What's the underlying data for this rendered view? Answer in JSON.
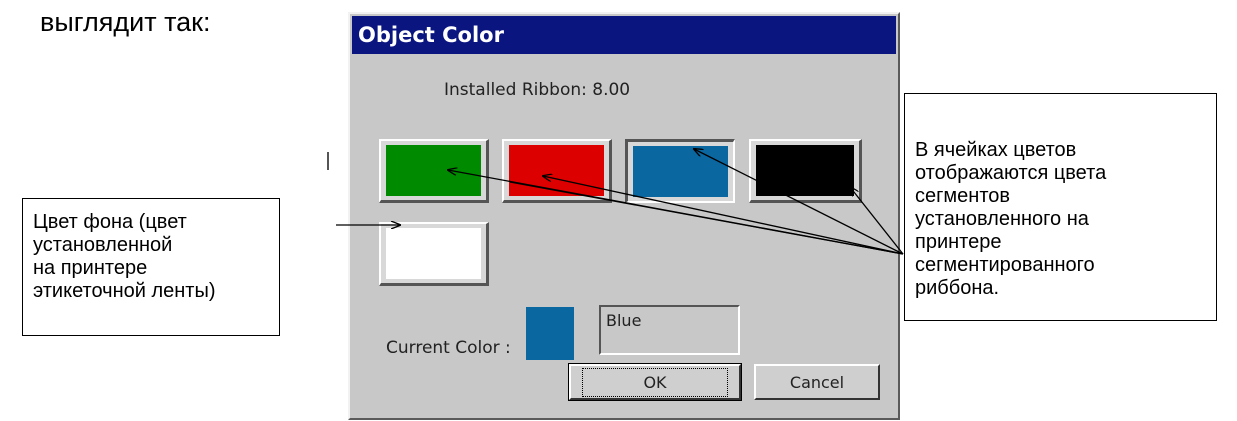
{
  "intro_text": "выглядит так:",
  "dialog": {
    "title": "Object Color",
    "installed_label": "Installed Ribbon: 8.00",
    "swatches": [
      {
        "name": "green",
        "color": "#008a00",
        "selected": false
      },
      {
        "name": "red",
        "color": "#dd0000",
        "selected": false
      },
      {
        "name": "blue",
        "color": "#0a67a0",
        "selected": true
      },
      {
        "name": "black",
        "color": "#000000",
        "selected": false
      },
      {
        "name": "white",
        "color": "#ffffff",
        "selected": false
      }
    ],
    "current_color_label": "Current Color :",
    "current_color_value": "#0a67a0",
    "current_color_name": "Blue",
    "ok_label": "OK",
    "cancel_label": "Cancel"
  },
  "callouts": {
    "left_lines": [
      "Цвет фона (цвет",
      "установленной",
      "на принтере",
      "этикеточной ленты)"
    ],
    "right_lines": [
      "В ячейках цветов",
      "отображаются цвета",
      "сегментов",
      "установленного на",
      "принтере",
      "сегментированного",
      "риббона."
    ]
  }
}
